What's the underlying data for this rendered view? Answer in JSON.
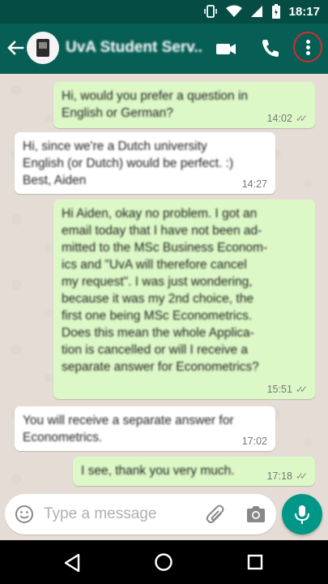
{
  "status_bar": {
    "time": "18:17"
  },
  "header": {
    "title": "UvA Student Serv..."
  },
  "messages": [
    {
      "direction": "out",
      "text": "Hi, would you prefer a question in\nEnglish or German?",
      "time": "14:02",
      "ticks": "✓✓"
    },
    {
      "direction": "in",
      "text": "Hi, since we're a Dutch university\nEnglish (or Dutch) would be perfect. :)\nBest, Aiden",
      "time": "14:27"
    },
    {
      "direction": "out",
      "text": "Hi Aiden, okay no problem. I got an\nemail today that I have not been ad-\nmitted to the MSc Business Econom-\nics and \"UvA will therefore cancel\nmy request\". I was just wondering,\nbecause it was my 2nd choice, the\nfirst one being MSc Econometrics.\nDoes this mean the whole Applica-\ntion is cancelled or will I receive a\nseparate answer for Econometrics?",
      "time": "15:51",
      "ticks": "✓✓"
    },
    {
      "direction": "in",
      "text": "You will receive a separate answer for\nEconometrics.",
      "time": "17:02"
    },
    {
      "direction": "out",
      "text": "I see, thank you very much.",
      "time": "17:18",
      "ticks": "✓✓"
    }
  ],
  "input": {
    "placeholder": "Type a message"
  },
  "colors": {
    "header": "#075e54",
    "status_bar": "#054d44",
    "outgoing_bubble": "#dcf8c6",
    "incoming_bubble": "#ffffff",
    "accent": "#009688",
    "highlight_ring": "#d92b2b"
  },
  "icons": [
    "back-arrow-icon",
    "video-call-icon",
    "phone-icon",
    "more-vert-icon",
    "emoji-icon",
    "attach-icon",
    "camera-icon",
    "mic-icon",
    "vibrate-icon",
    "wifi-icon",
    "signal-icon",
    "battery-icon",
    "nav-back-icon",
    "nav-home-icon",
    "nav-recent-icon"
  ]
}
